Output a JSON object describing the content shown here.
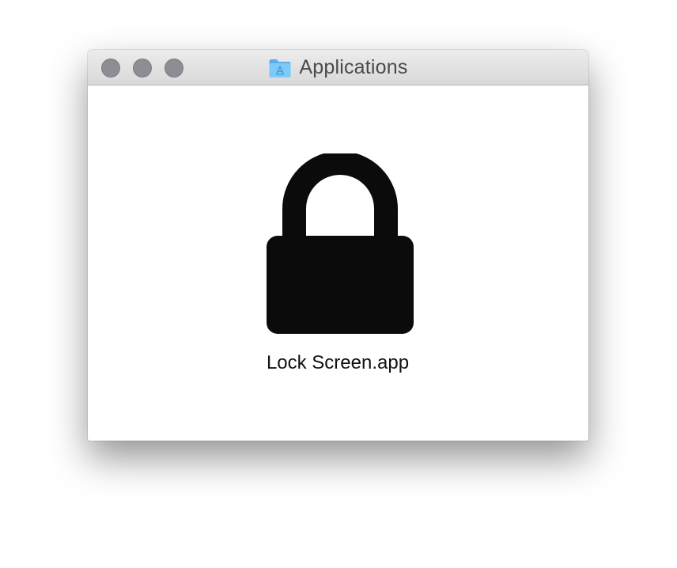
{
  "window": {
    "title": "Applications",
    "folder_icon": "applications-folder-icon",
    "controls": {
      "close_icon": "close-icon",
      "minimize_icon": "minimize-icon",
      "zoom_icon": "zoom-icon",
      "inactive_color": "#8e8d93"
    }
  },
  "content": {
    "items": [
      {
        "label": "Lock Screen.app",
        "icon": "lock-icon"
      }
    ]
  },
  "colors": {
    "folder_blue": "#5fb7f3",
    "lock_black": "#0b0b0b"
  }
}
